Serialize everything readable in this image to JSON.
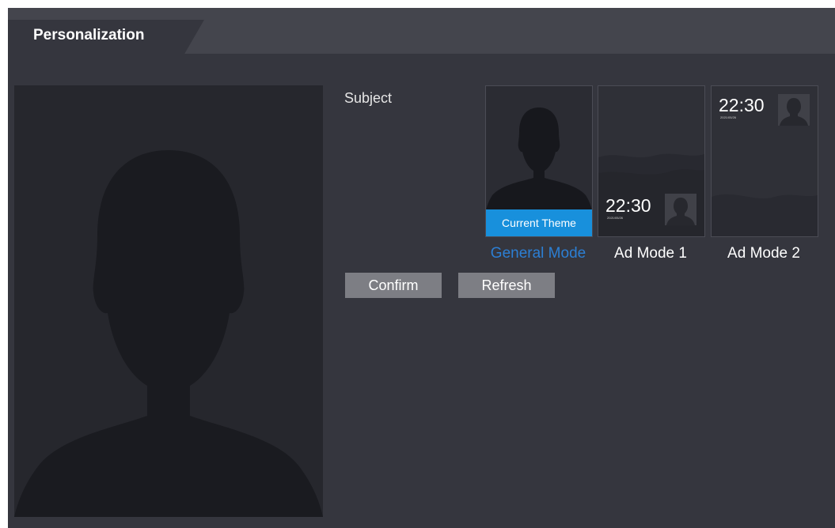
{
  "tab": {
    "label": "Personalization"
  },
  "subject_label": "Subject",
  "themes": [
    {
      "name": "General Mode",
      "badge": "Current Theme",
      "current": true
    },
    {
      "name": "Ad Mode 1",
      "clock": "22:30",
      "date": "2021/05/26"
    },
    {
      "name": "Ad Mode 2",
      "clock": "22:30",
      "date": "2021/05/26"
    }
  ],
  "buttons": {
    "confirm": "Confirm",
    "refresh": "Refresh"
  },
  "colors": {
    "background": "#35363e",
    "tab_bar": "#44454d",
    "accent": "#1890dc",
    "active_link": "#2c7fd4",
    "button": "#7d7e84"
  }
}
